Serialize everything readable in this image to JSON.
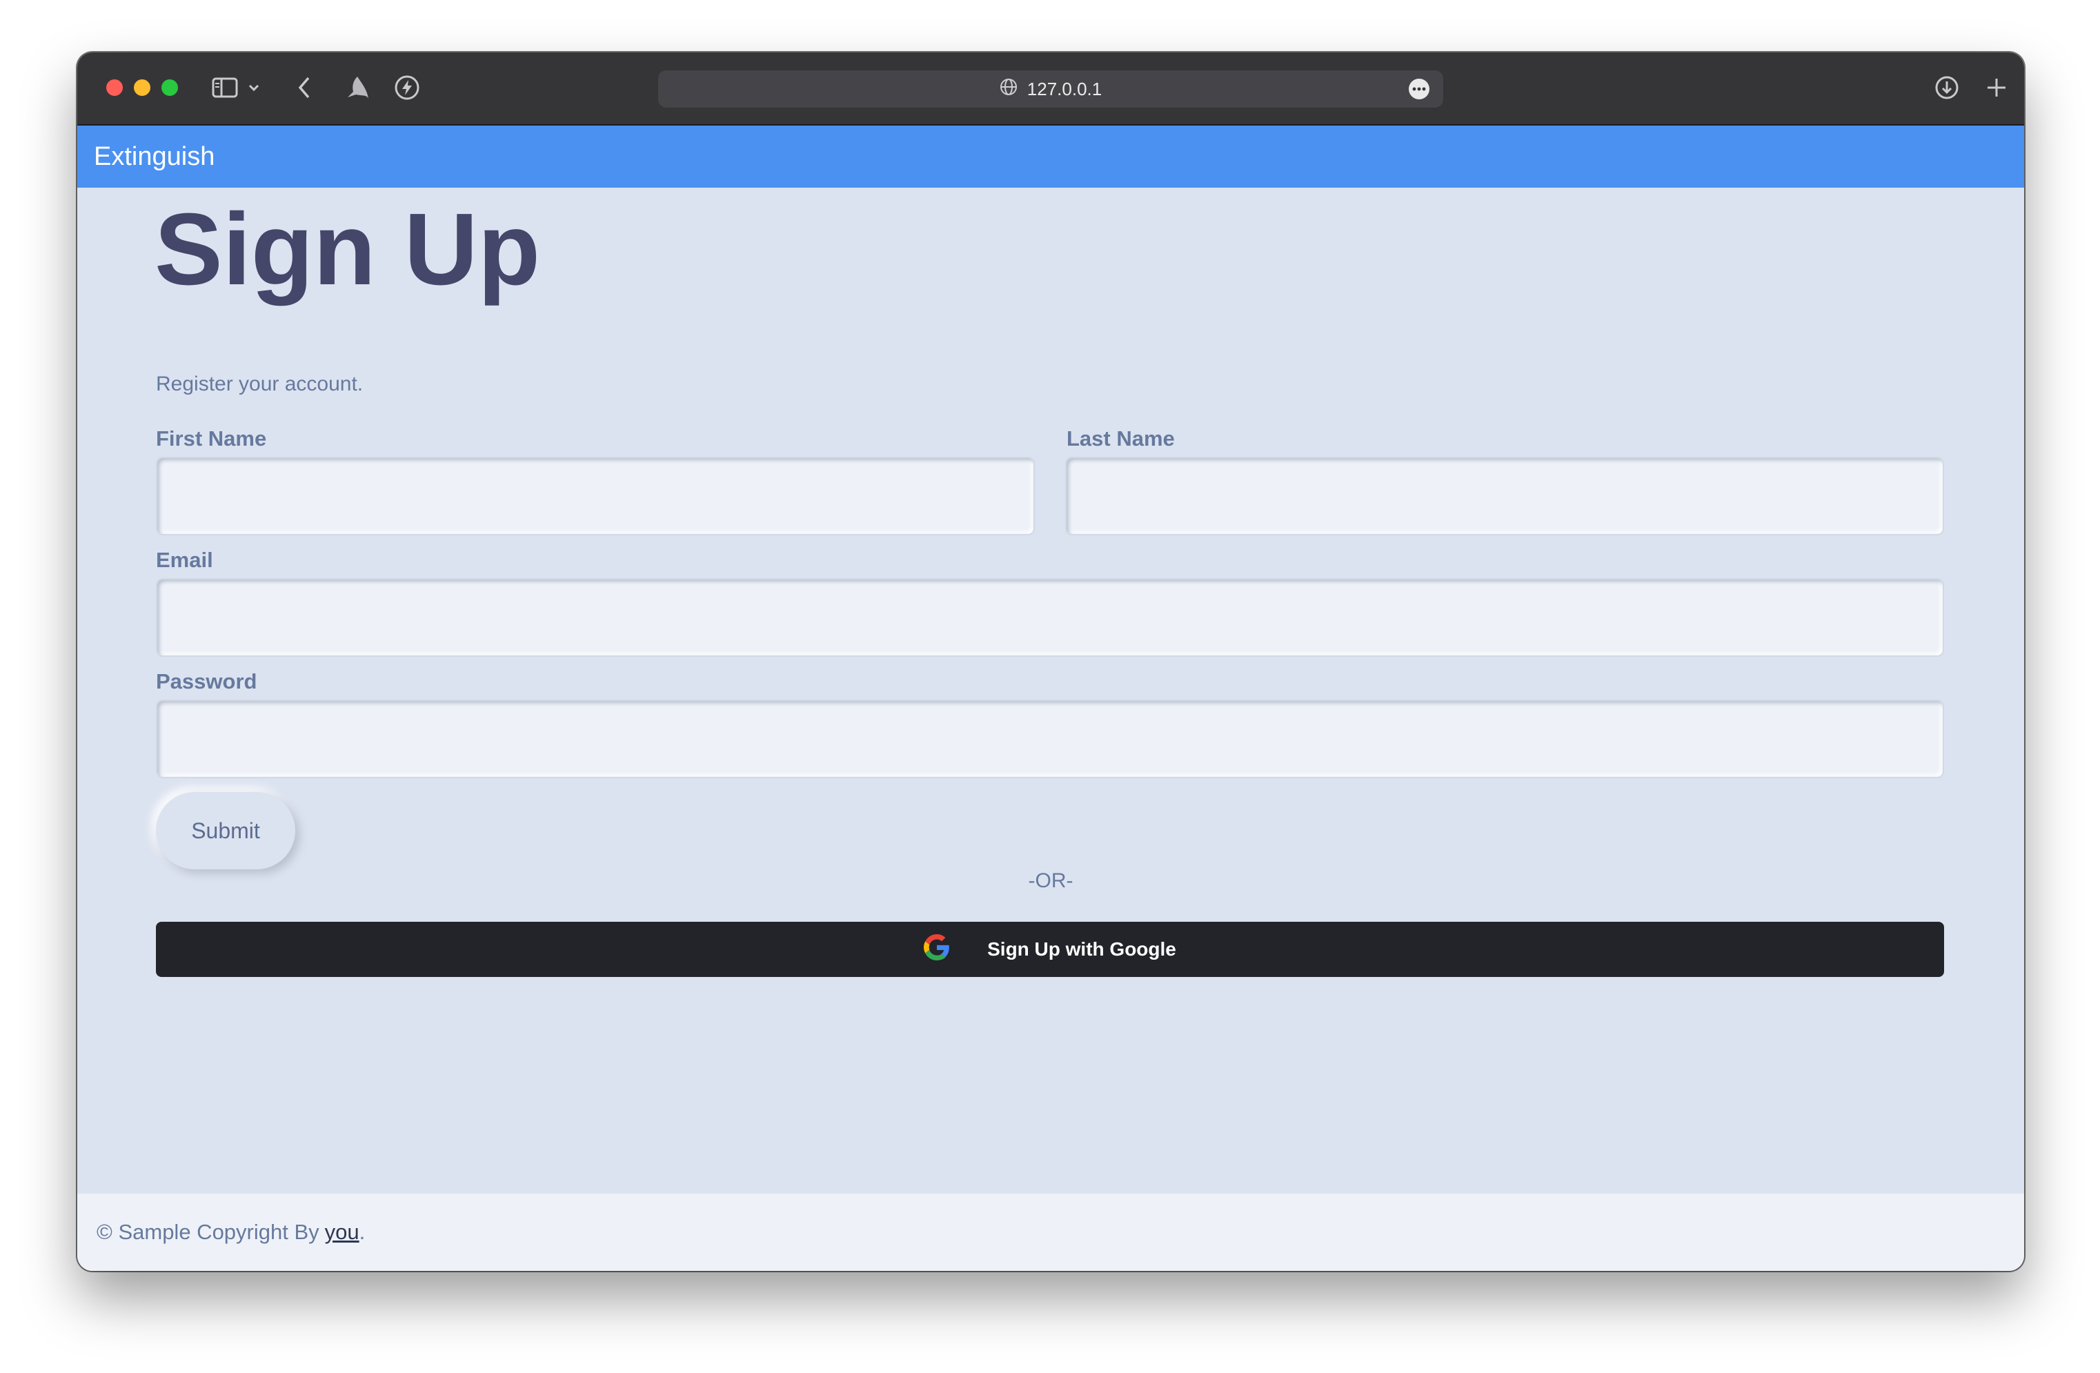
{
  "browser": {
    "url": "127.0.0.1",
    "icons": [
      "sidebar-icon",
      "chevron-down-icon",
      "back-arrow-icon",
      "bird-extension-icon",
      "bolt-extension-icon",
      "globe-icon",
      "more-icon",
      "download-icon",
      "plus-icon"
    ]
  },
  "navbar": {
    "brand": "Extinguish",
    "color": "#4b91f1"
  },
  "form": {
    "title": "Sign Up",
    "subtitle": "Register your account.",
    "first_name_label": "First Name",
    "first_name_value": "",
    "last_name_label": "Last Name",
    "last_name_value": "",
    "email_label": "Email",
    "email_value": "",
    "password_label": "Password",
    "password_value": "",
    "submit_label": "Submit",
    "or_text": "-OR-",
    "google_label": "Sign Up with Google"
  },
  "footer": {
    "text": "© Sample Copyright By",
    "link": "you",
    "suffix": "."
  },
  "colors": {
    "background": "#dce3f0",
    "text": "#44476a",
    "muted": "#66799e",
    "google_button": "#222429"
  }
}
